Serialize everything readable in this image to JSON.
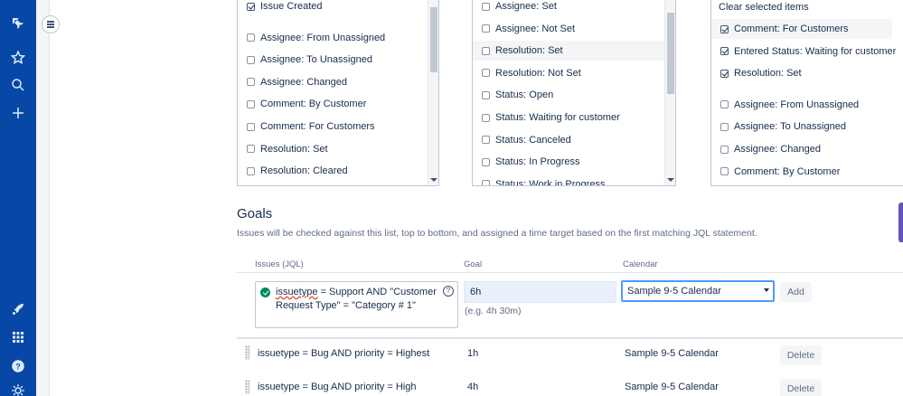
{
  "nav": {
    "icons": [
      "jira-logo-icon",
      "star-icon",
      "search-icon",
      "plus-icon",
      "rocket-icon",
      "app-switcher-icon",
      "help-icon",
      "settings-icon"
    ]
  },
  "lists": {
    "left": {
      "items": [
        {
          "label": "Issue Created",
          "checked": true
        },
        {
          "label": "Assignee: From Unassigned",
          "checked": false
        },
        {
          "label": "Assignee: To Unassigned",
          "checked": false
        },
        {
          "label": "Assignee: Changed",
          "checked": false
        },
        {
          "label": "Comment: By Customer",
          "checked": false
        },
        {
          "label": "Comment: For Customers",
          "checked": false
        },
        {
          "label": "Resolution: Set",
          "checked": false
        },
        {
          "label": "Resolution: Cleared",
          "checked": false
        }
      ]
    },
    "middle": {
      "items": [
        {
          "label": "Assignee: Set",
          "checked": false
        },
        {
          "label": "Assignee: Not Set",
          "checked": false
        },
        {
          "label": "Resolution: Set",
          "checked": false
        },
        {
          "label": "Resolution: Not Set",
          "checked": false
        },
        {
          "label": "Status: Open",
          "checked": false
        },
        {
          "label": "Status: Waiting for customer",
          "checked": false
        },
        {
          "label": "Status: Canceled",
          "checked": false
        },
        {
          "label": "Status: In Progress",
          "checked": false
        },
        {
          "label": "Status: Work in Progress",
          "checked": false
        }
      ]
    },
    "right": {
      "clear_label": "Clear selected items",
      "items": [
        {
          "label": "Comment: For Customers",
          "checked": true
        },
        {
          "label": "Entered Status: Waiting for customer",
          "checked": true
        },
        {
          "label": "Resolution: Set",
          "checked": true
        },
        {
          "label": "Assignee: From Unassigned",
          "checked": false
        },
        {
          "label": "Assignee: To Unassigned",
          "checked": false
        },
        {
          "label": "Assignee: Changed",
          "checked": false
        },
        {
          "label": "Comment: By Customer",
          "checked": false
        }
      ]
    }
  },
  "goals": {
    "title": "Goals",
    "description": "Issues will be checked against this list, top to bottom, and assigned a time target based on the first matching JQL statement.",
    "columns": {
      "issues": "Issues (JQL)",
      "goal": "Goal",
      "calendar": "Calendar"
    },
    "new": {
      "jql_keyword": "issuetype",
      "jql_rest": " = Support AND \"Customer Request Type\" = \"Category # 1\"",
      "help": "?",
      "goal_value": "6h",
      "goal_hint": "(e.g. 4h 30m)",
      "calendar_value": "Sample 9-5 Calendar",
      "add_label": "Add"
    },
    "rows": [
      {
        "jql": "issuetype = Bug AND priority = Highest",
        "goal": "1h",
        "calendar": "Sample 9-5 Calendar",
        "delete_label": "Delete"
      },
      {
        "jql": "issuetype = Bug AND priority = High",
        "goal": "4h",
        "calendar": "Sample 9-5 Calendar",
        "delete_label": "Delete"
      }
    ]
  },
  "colors": {
    "nav": "#0747a6",
    "focus": "#4c9aff",
    "success": "#00875a"
  }
}
